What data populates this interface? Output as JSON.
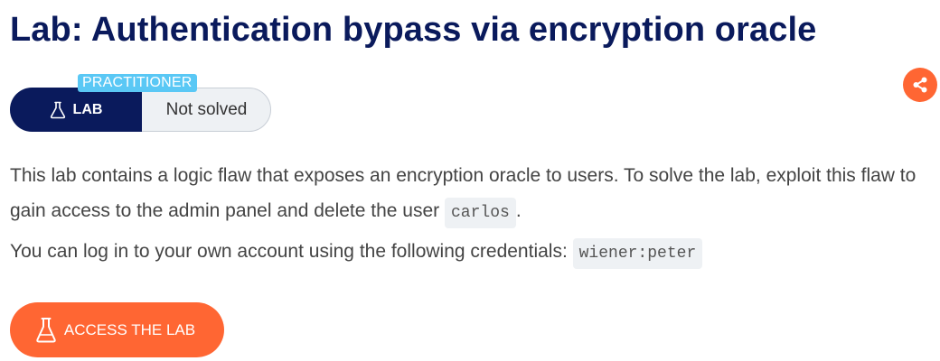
{
  "page": {
    "title": "Lab: Authentication bypass via encryption oracle"
  },
  "share": {
    "icon": "share-icon",
    "color": "#ff6633"
  },
  "status_widget": {
    "level_badge": "PRACTITIONER",
    "lab_label": "LAB",
    "lab_icon": "flask-icon",
    "status": "Not solved",
    "colors": {
      "lab_bg": "#0a1a5c",
      "badge_bg": "#5ac8f5",
      "status_bg": "#eef1f4"
    }
  },
  "description": {
    "p1_text": "This lab contains a logic flaw that exposes an encryption oracle to users. To solve the lab, exploit this flaw to gain access to the admin panel and delete the user ",
    "p1_code": "carlos",
    "p1_end": ".",
    "p2_text": "You can log in to your own account using the following credentials: ",
    "p2_code": "wiener:peter"
  },
  "access_button": {
    "label": "ACCESS THE LAB",
    "icon": "flask-icon",
    "color": "#ff6633"
  }
}
